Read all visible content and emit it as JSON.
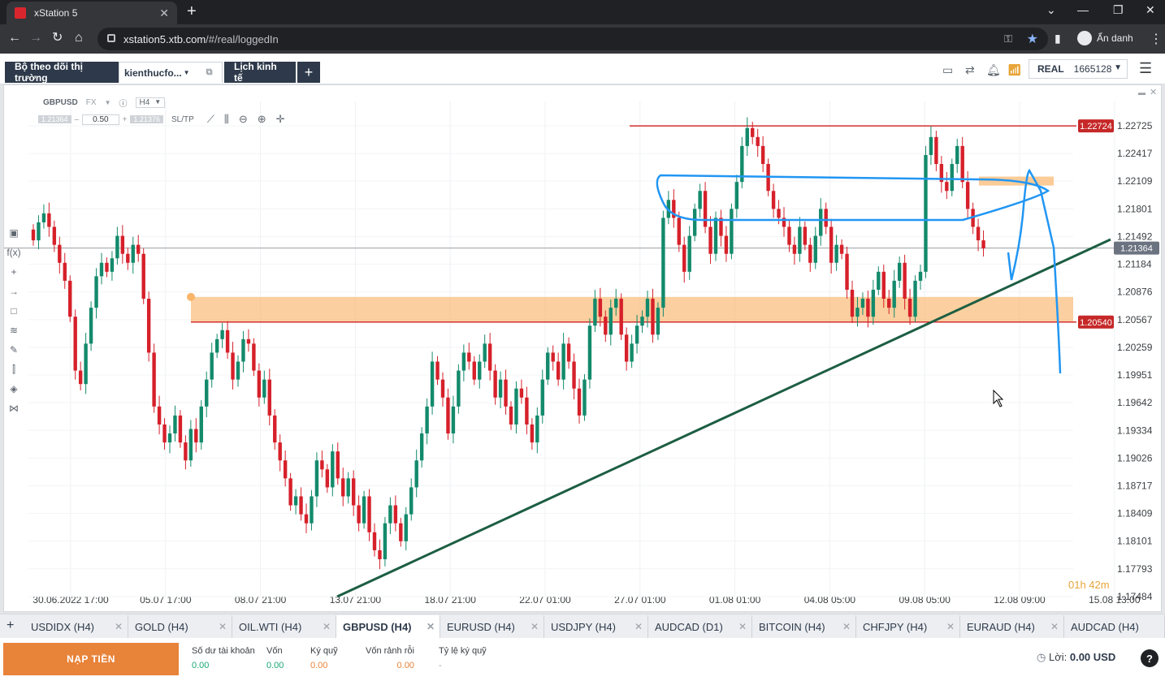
{
  "browser": {
    "tab_title": "xStation 5",
    "url_host": "xstation5.xtb.com",
    "url_path": "/#/real/loggedIn",
    "profile_name": "Ẩn danh"
  },
  "app": {
    "tabs": [
      {
        "label": "Bộ theo dõi thị trường"
      },
      {
        "label": "kienthucfo..."
      },
      {
        "label": "Lịch kinh tế"
      }
    ],
    "account_type": "REAL",
    "account_number": "1665128"
  },
  "chart_toolbar": {
    "symbol": "GBPUSD",
    "type": "FX",
    "timeframe": "H4",
    "bid": "1.21364",
    "volume": "0.50",
    "ask": "1.21376",
    "sltp": "SL/TP"
  },
  "chart_data": {
    "type": "candlestick",
    "y_ticks": [
      "1.22725",
      "1.22417",
      "1.22109",
      "1.21801",
      "1.21492",
      "1.21184",
      "1.20876",
      "1.20567",
      "1.20259",
      "1.19951",
      "1.19642",
      "1.19334",
      "1.19026",
      "1.18717",
      "1.18409",
      "1.18101",
      "1.17793",
      "1.17484"
    ],
    "x_ticks": [
      "30.06.2022 17:00",
      "05.07 17:00",
      "08.07 21:00",
      "13.07 21:00",
      "18.07 21:00",
      "22.07 01:00",
      "27.07 01:00",
      "01.08 01:00",
      "04.08 05:00",
      "09.08 05:00",
      "12.08 09:00",
      "15.08 13:00"
    ],
    "ylim": [
      1.17484,
      1.22725
    ],
    "price_labels": [
      {
        "value": 1.22724,
        "label": "1.22724",
        "color": "#c62828"
      },
      {
        "value": 1.2054,
        "label": "1.20540",
        "color": "#c62828"
      },
      {
        "value": 1.21364,
        "label": "1.21364",
        "color": "#6b7280"
      }
    ],
    "zone": {
      "low": 1.2054,
      "high": 1.2082
    },
    "countdown": "01h 42m",
    "closes": [
      1.2145,
      1.2165,
      1.2175,
      1.216,
      1.214,
      1.212,
      1.21,
      1.206,
      1.2,
      1.1985,
      1.203,
      1.207,
      1.2105,
      1.212,
      1.211,
      1.2125,
      1.215,
      1.213,
      1.212,
      1.214,
      1.213,
      1.208,
      1.202,
      1.196,
      1.194,
      1.192,
      1.193,
      1.195,
      1.192,
      1.19,
      1.1935,
      1.192,
      1.196,
      1.199,
      1.202,
      1.2035,
      1.2045,
      1.202,
      1.199,
      1.201,
      1.2035,
      1.203,
      1.2,
      1.197,
      1.199,
      1.195,
      1.192,
      1.19,
      1.188,
      1.185,
      1.186,
      1.184,
      1.183,
      1.186,
      1.19,
      1.189,
      1.187,
      1.191,
      1.188,
      1.186,
      1.188,
      1.185,
      1.183,
      1.186,
      1.182,
      1.18,
      1.179,
      1.183,
      1.185,
      1.183,
      1.181,
      1.184,
      1.187,
      1.19,
      1.193,
      1.196,
      1.201,
      1.199,
      1.197,
      1.193,
      1.196,
      1.2,
      1.202,
      1.201,
      1.199,
      1.201,
      1.203,
      1.2,
      1.197,
      1.199,
      1.196,
      1.194,
      1.198,
      1.197,
      1.194,
      1.192,
      1.195,
      1.199,
      1.202,
      1.201,
      1.199,
      1.203,
      1.201,
      1.198,
      1.195,
      1.199,
      1.205,
      1.208,
      1.206,
      1.204,
      1.207,
      1.208,
      1.204,
      1.201,
      1.203,
      1.205,
      1.206,
      1.208,
      1.204,
      1.207,
      1.217,
      1.219,
      1.217,
      1.214,
      1.211,
      1.215,
      1.218,
      1.22,
      1.216,
      1.213,
      1.217,
      1.215,
      1.213,
      1.218,
      1.221,
      1.225,
      1.227,
      1.226,
      1.225,
      1.223,
      1.22,
      1.218,
      1.217,
      1.216,
      1.214,
      1.213,
      1.216,
      1.214,
      1.212,
      1.215,
      1.218,
      1.216,
      1.212,
      1.214,
      1.213,
      1.209,
      1.206,
      1.207,
      1.208,
      1.206,
      1.209,
      1.211,
      1.208,
      1.207,
      1.21,
      1.212,
      1.208,
      1.206,
      1.21,
      1.211,
      1.224,
      1.226,
      1.223,
      1.221,
      1.22,
      1.223,
      1.225,
      1.221,
      1.218,
      1.216,
      1.2145,
      1.2136
    ]
  },
  "instrument_tabs": [
    "USDIDX (H4)",
    "GOLD (H4)",
    "OIL.WTI (H4)",
    "GBPUSD (H4)",
    "EURUSD (H4)",
    "USDJPY (H4)",
    "AUDCAD (D1)",
    "BITCOIN (H4)",
    "CHFJPY (H4)",
    "EURAUD (H4)",
    "AUDCAD (H4)"
  ],
  "bottom": {
    "deposit_label": "NẠP TIỀN",
    "stats": [
      {
        "label": "Số dư tài khoản",
        "value": "0.00"
      },
      {
        "label": "Vốn",
        "value": "0.00"
      },
      {
        "label": "Ký quỹ",
        "value": "0.00"
      },
      {
        "label": "Vốn rảnh rỗi",
        "value": "0.00"
      },
      {
        "label": "Tỷ lệ ký quỹ",
        "value": "-"
      }
    ],
    "profit_label": "Lời:",
    "profit_value": "0.00 USD"
  }
}
